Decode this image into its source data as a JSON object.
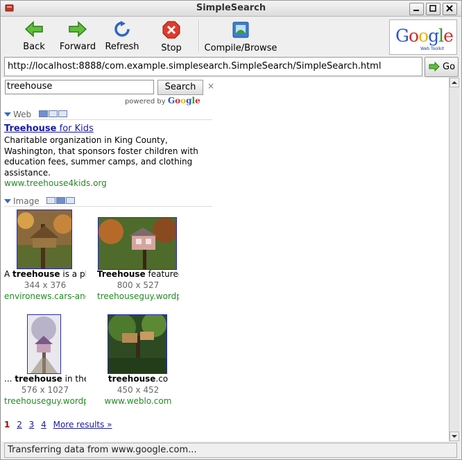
{
  "window": {
    "title": "SimpleSearch"
  },
  "toolbar": {
    "back": "Back",
    "forward": "Forward",
    "refresh": "Refresh",
    "stop": "Stop",
    "compile": "Compile/Browse",
    "logo_brand": "Google",
    "logo_sub": "Web Toolkit"
  },
  "urlbar": {
    "url": "http://localhost:8888/com.example.simplesearch.SimpleSearch/SimpleSearch.html",
    "go": "Go"
  },
  "search": {
    "query": "treehouse",
    "button": "Search",
    "clear": "×",
    "powered_by": "powered by",
    "powered_brand": "Google"
  },
  "web": {
    "section": "Web",
    "title_bold": "Treehouse",
    "title_rest": " for Kids",
    "description": "Charitable organization in King County, Washington, that sponsors foster children with education fees, summer camps, and clothing assistance.",
    "url": "www.treehouse4kids.org"
  },
  "image": {
    "section": "Image",
    "results": [
      {
        "prefix": "A ",
        "bold": "treehouse",
        "suffix": " is a pl",
        "dims": "344 x 376",
        "site": "environews.cars-and"
      },
      {
        "prefix": "",
        "bold": "Treehouse",
        "suffix": " featured",
        "dims": "800 x 527",
        "site": "treehouseguy.wordp"
      },
      {
        "prefix": "... ",
        "bold": "treehouse",
        "suffix": " in the",
        "dims": "576 x 1027",
        "site": "treehouseguy.wordp"
      },
      {
        "prefix": "",
        "bold": "treehouse",
        "suffix": ".co",
        "dims": "450 x 452",
        "site": "www.weblo.com"
      }
    ]
  },
  "pagination": {
    "p1": "1",
    "p2": "2",
    "p3": "3",
    "p4": "4",
    "more": "More results »"
  },
  "status": {
    "text": "Transferring data from www.google.com..."
  }
}
